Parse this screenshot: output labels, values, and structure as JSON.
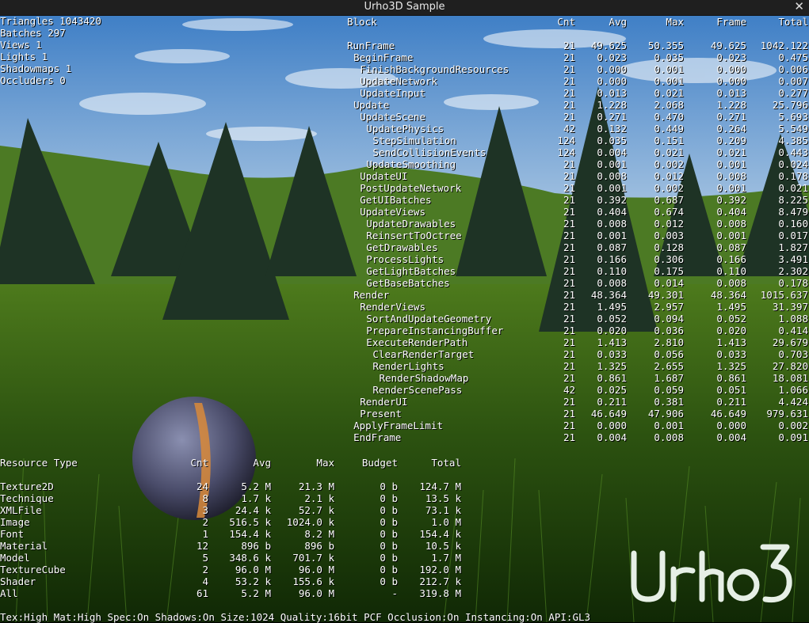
{
  "window": {
    "title": "Urho3D Sample",
    "close_glyph": "✕"
  },
  "stats": [
    "Triangles 1043420",
    "Batches 297",
    "Views 1",
    "Lights 1",
    "Shadowmaps 1",
    "Occluders 0"
  ],
  "profiler": {
    "headers": {
      "block": "Block",
      "cnt": "Cnt",
      "avg": "Avg",
      "max": "Max",
      "frame": "Frame",
      "total": "Total"
    },
    "rows": [
      {
        "depth": 0,
        "name": "RunFrame",
        "cnt": "21",
        "avg": "49.625",
        "max": "50.355",
        "frame": "49.625",
        "total": "1042.122"
      },
      {
        "depth": 1,
        "name": "BeginFrame",
        "cnt": "21",
        "avg": "0.023",
        "max": "0.035",
        "frame": "0.023",
        "total": "0.475"
      },
      {
        "depth": 2,
        "name": "FinishBackgroundResources",
        "cnt": "21",
        "avg": "0.000",
        "max": "0.001",
        "frame": "0.000",
        "total": "0.006"
      },
      {
        "depth": 2,
        "name": "UpdateNetwork",
        "cnt": "21",
        "avg": "0.000",
        "max": "0.001",
        "frame": "0.000",
        "total": "0.007"
      },
      {
        "depth": 2,
        "name": "UpdateInput",
        "cnt": "21",
        "avg": "0.013",
        "max": "0.021",
        "frame": "0.013",
        "total": "0.277"
      },
      {
        "depth": 1,
        "name": "Update",
        "cnt": "21",
        "avg": "1.228",
        "max": "2.068",
        "frame": "1.228",
        "total": "25.796"
      },
      {
        "depth": 2,
        "name": "UpdateScene",
        "cnt": "21",
        "avg": "0.271",
        "max": "0.470",
        "frame": "0.271",
        "total": "5.693"
      },
      {
        "depth": 3,
        "name": "UpdatePhysics",
        "cnt": "42",
        "avg": "0.132",
        "max": "0.449",
        "frame": "0.264",
        "total": "5.549"
      },
      {
        "depth": 4,
        "name": "StepSimulation",
        "cnt": "124",
        "avg": "0.035",
        "max": "0.151",
        "frame": "0.209",
        "total": "4.385"
      },
      {
        "depth": 4,
        "name": "SendCollisionEvents",
        "cnt": "124",
        "avg": "0.004",
        "max": "0.021",
        "frame": "0.021",
        "total": "0.443"
      },
      {
        "depth": 3,
        "name": "UpdateSmoothing",
        "cnt": "21",
        "avg": "0.001",
        "max": "0.002",
        "frame": "0.001",
        "total": "0.024"
      },
      {
        "depth": 2,
        "name": "UpdateUI",
        "cnt": "21",
        "avg": "0.008",
        "max": "0.012",
        "frame": "0.008",
        "total": "0.178"
      },
      {
        "depth": 2,
        "name": "PostUpdateNetwork",
        "cnt": "21",
        "avg": "0.001",
        "max": "0.002",
        "frame": "0.001",
        "total": "0.021"
      },
      {
        "depth": 2,
        "name": "GetUIBatches",
        "cnt": "21",
        "avg": "0.392",
        "max": "0.687",
        "frame": "0.392",
        "total": "8.225"
      },
      {
        "depth": 2,
        "name": "UpdateViews",
        "cnt": "21",
        "avg": "0.404",
        "max": "0.674",
        "frame": "0.404",
        "total": "8.479"
      },
      {
        "depth": 3,
        "name": "UpdateDrawables",
        "cnt": "21",
        "avg": "0.008",
        "max": "0.012",
        "frame": "0.008",
        "total": "0.160"
      },
      {
        "depth": 3,
        "name": "ReinsertToOctree",
        "cnt": "21",
        "avg": "0.001",
        "max": "0.003",
        "frame": "0.001",
        "total": "0.017"
      },
      {
        "depth": 3,
        "name": "GetDrawables",
        "cnt": "21",
        "avg": "0.087",
        "max": "0.128",
        "frame": "0.087",
        "total": "1.827"
      },
      {
        "depth": 3,
        "name": "ProcessLights",
        "cnt": "21",
        "avg": "0.166",
        "max": "0.306",
        "frame": "0.166",
        "total": "3.491"
      },
      {
        "depth": 3,
        "name": "GetLightBatches",
        "cnt": "21",
        "avg": "0.110",
        "max": "0.175",
        "frame": "0.110",
        "total": "2.302"
      },
      {
        "depth": 3,
        "name": "GetBaseBatches",
        "cnt": "21",
        "avg": "0.008",
        "max": "0.014",
        "frame": "0.008",
        "total": "0.178"
      },
      {
        "depth": 1,
        "name": "Render",
        "cnt": "21",
        "avg": "48.364",
        "max": "49.301",
        "frame": "48.364",
        "total": "1015.637"
      },
      {
        "depth": 2,
        "name": "RenderViews",
        "cnt": "21",
        "avg": "1.495",
        "max": "2.957",
        "frame": "1.495",
        "total": "31.397"
      },
      {
        "depth": 3,
        "name": "SortAndUpdateGeometry",
        "cnt": "21",
        "avg": "0.052",
        "max": "0.094",
        "frame": "0.052",
        "total": "1.088"
      },
      {
        "depth": 3,
        "name": "PrepareInstancingBuffer",
        "cnt": "21",
        "avg": "0.020",
        "max": "0.036",
        "frame": "0.020",
        "total": "0.414"
      },
      {
        "depth": 3,
        "name": "ExecuteRenderPath",
        "cnt": "21",
        "avg": "1.413",
        "max": "2.810",
        "frame": "1.413",
        "total": "29.679"
      },
      {
        "depth": 4,
        "name": "ClearRenderTarget",
        "cnt": "21",
        "avg": "0.033",
        "max": "0.056",
        "frame": "0.033",
        "total": "0.703"
      },
      {
        "depth": 4,
        "name": "RenderLights",
        "cnt": "21",
        "avg": "1.325",
        "max": "2.655",
        "frame": "1.325",
        "total": "27.820"
      },
      {
        "depth": 5,
        "name": "RenderShadowMap",
        "cnt": "21",
        "avg": "0.861",
        "max": "1.687",
        "frame": "0.861",
        "total": "18.081"
      },
      {
        "depth": 4,
        "name": "RenderScenePass",
        "cnt": "42",
        "avg": "0.025",
        "max": "0.059",
        "frame": "0.051",
        "total": "1.066"
      },
      {
        "depth": 2,
        "name": "RenderUI",
        "cnt": "21",
        "avg": "0.211",
        "max": "0.381",
        "frame": "0.211",
        "total": "4.424"
      },
      {
        "depth": 2,
        "name": "Present",
        "cnt": "21",
        "avg": "46.649",
        "max": "47.906",
        "frame": "46.649",
        "total": "979.631"
      },
      {
        "depth": 1,
        "name": "ApplyFrameLimit",
        "cnt": "21",
        "avg": "0.000",
        "max": "0.001",
        "frame": "0.000",
        "total": "0.002"
      },
      {
        "depth": 1,
        "name": "EndFrame",
        "cnt": "21",
        "avg": "0.004",
        "max": "0.008",
        "frame": "0.004",
        "total": "0.091"
      }
    ]
  },
  "resources": {
    "headers": {
      "type": "Resource Type",
      "cnt": "Cnt",
      "avg": "Avg",
      "max": "Max",
      "budget": "Budget",
      "total": "Total"
    },
    "rows": [
      {
        "type": "Texture2D",
        "cnt": "24",
        "avg": "5.2 M",
        "max": "21.3 M",
        "budget": "0 b",
        "total": "124.7 M"
      },
      {
        "type": "Technique",
        "cnt": "8",
        "avg": "1.7 k",
        "max": "2.1 k",
        "budget": "0 b",
        "total": "13.5 k"
      },
      {
        "type": "XMLFile",
        "cnt": "3",
        "avg": "24.4 k",
        "max": "52.7 k",
        "budget": "0 b",
        "total": "73.1 k"
      },
      {
        "type": "Image",
        "cnt": "2",
        "avg": "516.5 k",
        "max": "1024.0 k",
        "budget": "0 b",
        "total": "1.0 M"
      },
      {
        "type": "Font",
        "cnt": "1",
        "avg": "154.4 k",
        "max": "8.2 M",
        "budget": "0 b",
        "total": "154.4 k"
      },
      {
        "type": "Material",
        "cnt": "12",
        "avg": "896 b",
        "max": "896 b",
        "budget": "0 b",
        "total": "10.5 k"
      },
      {
        "type": "Model",
        "cnt": "5",
        "avg": "348.6 k",
        "max": "701.7 k",
        "budget": "0 b",
        "total": "1.7 M"
      },
      {
        "type": "TextureCube",
        "cnt": "2",
        "avg": "96.0 M",
        "max": "96.0 M",
        "budget": "0 b",
        "total": "192.0 M"
      },
      {
        "type": "Shader",
        "cnt": "4",
        "avg": "53.2 k",
        "max": "155.6 k",
        "budget": "0 b",
        "total": "212.7 k"
      },
      {
        "type": "All",
        "cnt": "61",
        "avg": "5.2 M",
        "max": "96.0 M",
        "budget": "-",
        "total": "319.8 M"
      }
    ]
  },
  "settings_line": "Tex:High Mat:High Spec:On Shadows:On Size:1024 Quality:16bit PCF Occlusion:On Instancing:On API:GL3",
  "logo": {
    "text": "Urho3D",
    "color": "#e6efe6"
  },
  "colors": {
    "sky_top": "#4a86c8",
    "sky_bottom": "#a8c6e4",
    "hill": "#3f6b1e",
    "grass": "#1f3d0a",
    "tree": "#1c2e22"
  }
}
